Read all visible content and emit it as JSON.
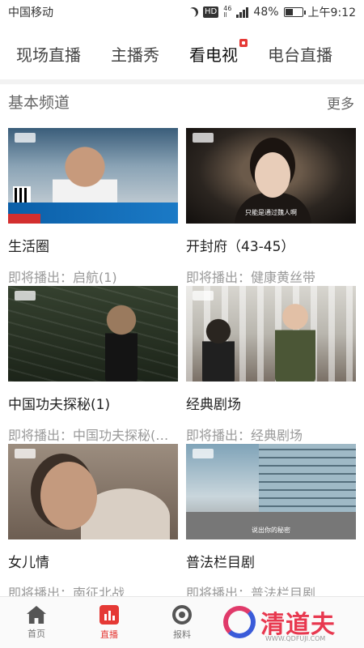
{
  "status_bar": {
    "carrier": "中国移动",
    "hd_badge": "HD",
    "network_top": "46",
    "network_bottom": "ll",
    "battery_percent": "48%",
    "battery_level": 0.48,
    "time": "上午9:12"
  },
  "tabs": [
    {
      "label": "现场直播",
      "active": false
    },
    {
      "label": "主播秀",
      "active": false
    },
    {
      "label": "看电视",
      "active": true,
      "badge": true
    },
    {
      "label": "电台直播",
      "active": false
    }
  ],
  "section": {
    "title": "基本频道",
    "more": "更多"
  },
  "channels": [
    {
      "title": "生活圈",
      "next": "即将播出：启航(1)",
      "subtitle": ""
    },
    {
      "title": "开封府（43-45）",
      "next": "即将播出：健康黄丝带",
      "subtitle": "只能是通过魏人啊"
    },
    {
      "title": "中国功夫探秘(1)",
      "next": "即将播出：中国功夫探秘(…",
      "subtitle": ""
    },
    {
      "title": "经典剧场",
      "next": "即将播出：经典剧场",
      "subtitle": ""
    },
    {
      "title": "女儿情",
      "next": "即将播出：南征北战",
      "subtitle": ""
    },
    {
      "title": "普法栏目剧",
      "next": "即将播出：普法栏目剧",
      "subtitle": "说出你的秘密"
    }
  ],
  "bottom_nav": [
    {
      "label": "首页",
      "icon": "home-icon",
      "active": false
    },
    {
      "label": "直播",
      "icon": "live-icon",
      "active": true
    },
    {
      "label": "报料",
      "icon": "report-icon",
      "active": false
    }
  ],
  "watermark": {
    "text": "清道夫",
    "url": "WWW.QDFUJI.COM"
  },
  "colors": {
    "accent": "#e53935",
    "text_primary": "#222222",
    "text_secondary": "#999999"
  }
}
